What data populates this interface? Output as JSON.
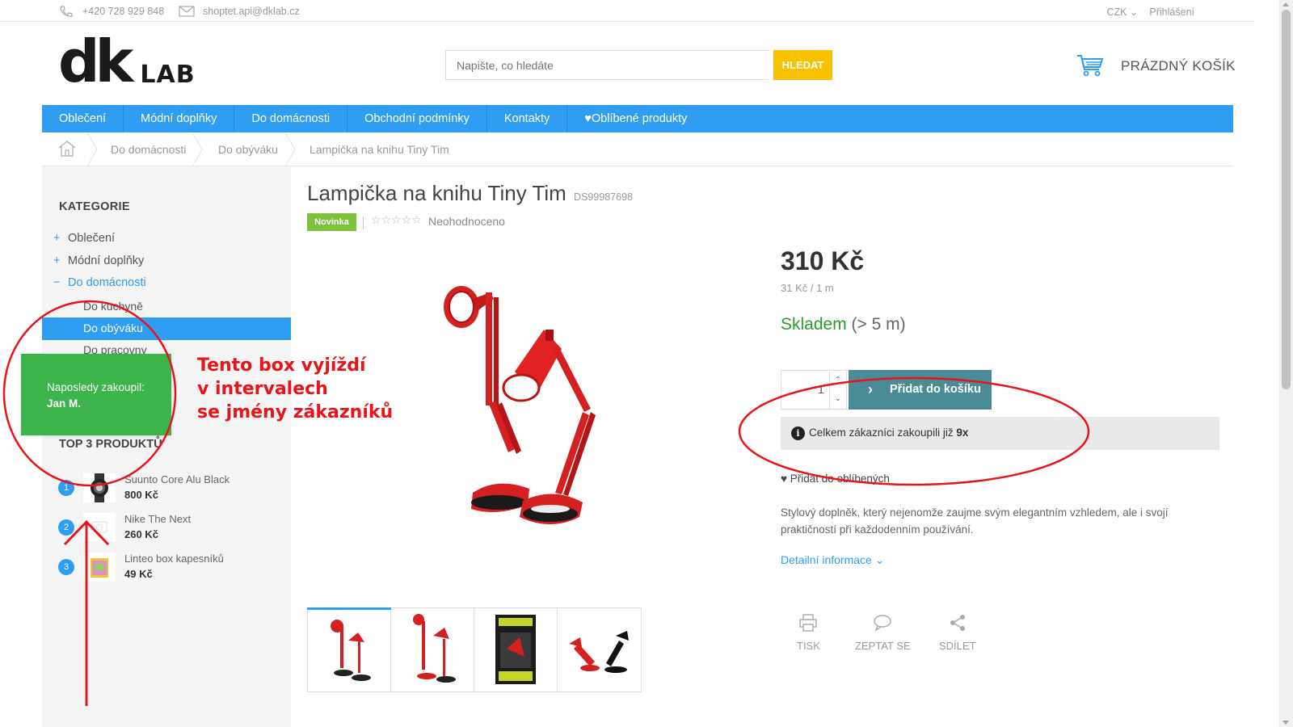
{
  "topbar": {
    "phone": "+420 728 929 848",
    "email": "shoptet.api@dklab.cz",
    "currency": "CZK",
    "login": "Přihlášení"
  },
  "logo": {
    "dk": "dk",
    "lab": "LAB"
  },
  "search": {
    "placeholder": "Napište, co hledáte",
    "button": "HLEDAT"
  },
  "cart": {
    "label": "PRÁZDNÝ KOŠÍK"
  },
  "nav": {
    "items": [
      "Oblečení",
      "Módní doplňky",
      "Do domácnosti",
      "Obchodní podmínky",
      "Kontakty",
      "Oblíbené produkty"
    ]
  },
  "breadcrumb": {
    "items": [
      "Do domácnosti",
      "Do obýváku",
      "Lampička na knihu Tiny Tim"
    ]
  },
  "sidebar": {
    "title": "KATEGORIE",
    "categories": [
      {
        "sign": "+",
        "label": "Oblečení"
      },
      {
        "sign": "+",
        "label": "Módní doplňky"
      },
      {
        "sign": "−",
        "label": "Do domácnosti"
      }
    ],
    "subcategories": [
      "Do kuchyně",
      "Do obýváku",
      "Do pracovny"
    ],
    "top3_title": "TOP 3 PRODUKTŮ",
    "top3": [
      {
        "num": "1",
        "name": "Suunto Core Alu Black",
        "price": "800 Kč"
      },
      {
        "num": "2",
        "name": "Nike The Next",
        "price": "260 Kč"
      },
      {
        "num": "3",
        "name": "Linteo box kapesníků",
        "price": "49 Kč"
      }
    ]
  },
  "popup": {
    "line1": "Naposledy zakoupil:",
    "line2": "Jan M."
  },
  "annotation": {
    "lines": [
      "Tento box vyjíždí",
      "v intervalech",
      "se jmény zákazníků"
    ],
    "color": "#e8141b"
  },
  "product": {
    "title": "Lampička na knihu Tiny Tim",
    "code": "DS99987698",
    "badge": "Novinka",
    "stars": "☆☆☆☆☆",
    "rating": "Neohodnoceno",
    "price": "310 Kč",
    "unit_price": "31 Kč / 1 m",
    "stock": "Skladem",
    "stock_detail": "(> 5 m)",
    "quantity": "1",
    "add_to_cart": "Přidat do košíku",
    "info_prefix": "Celkem zákazníci zakoupili již",
    "info_count": "9x",
    "favorite": "Přidat do oblíbených",
    "description": "Stylový doplněk, který nejenomže zaujme svým elegantním vzhledem, ale i svojí praktičností při každodenním používání.",
    "detail_link": "Detailní informace",
    "actions": [
      "TISK",
      "ZEPTAT SE",
      "SDÍLET"
    ]
  },
  "colors": {
    "primary": "#2e9df2",
    "search_button": "#f7c100",
    "popup": "#3cb44b",
    "cart_button": "#4a8b96",
    "stock": "#2a9d2a",
    "badge": "#7cc33b"
  }
}
